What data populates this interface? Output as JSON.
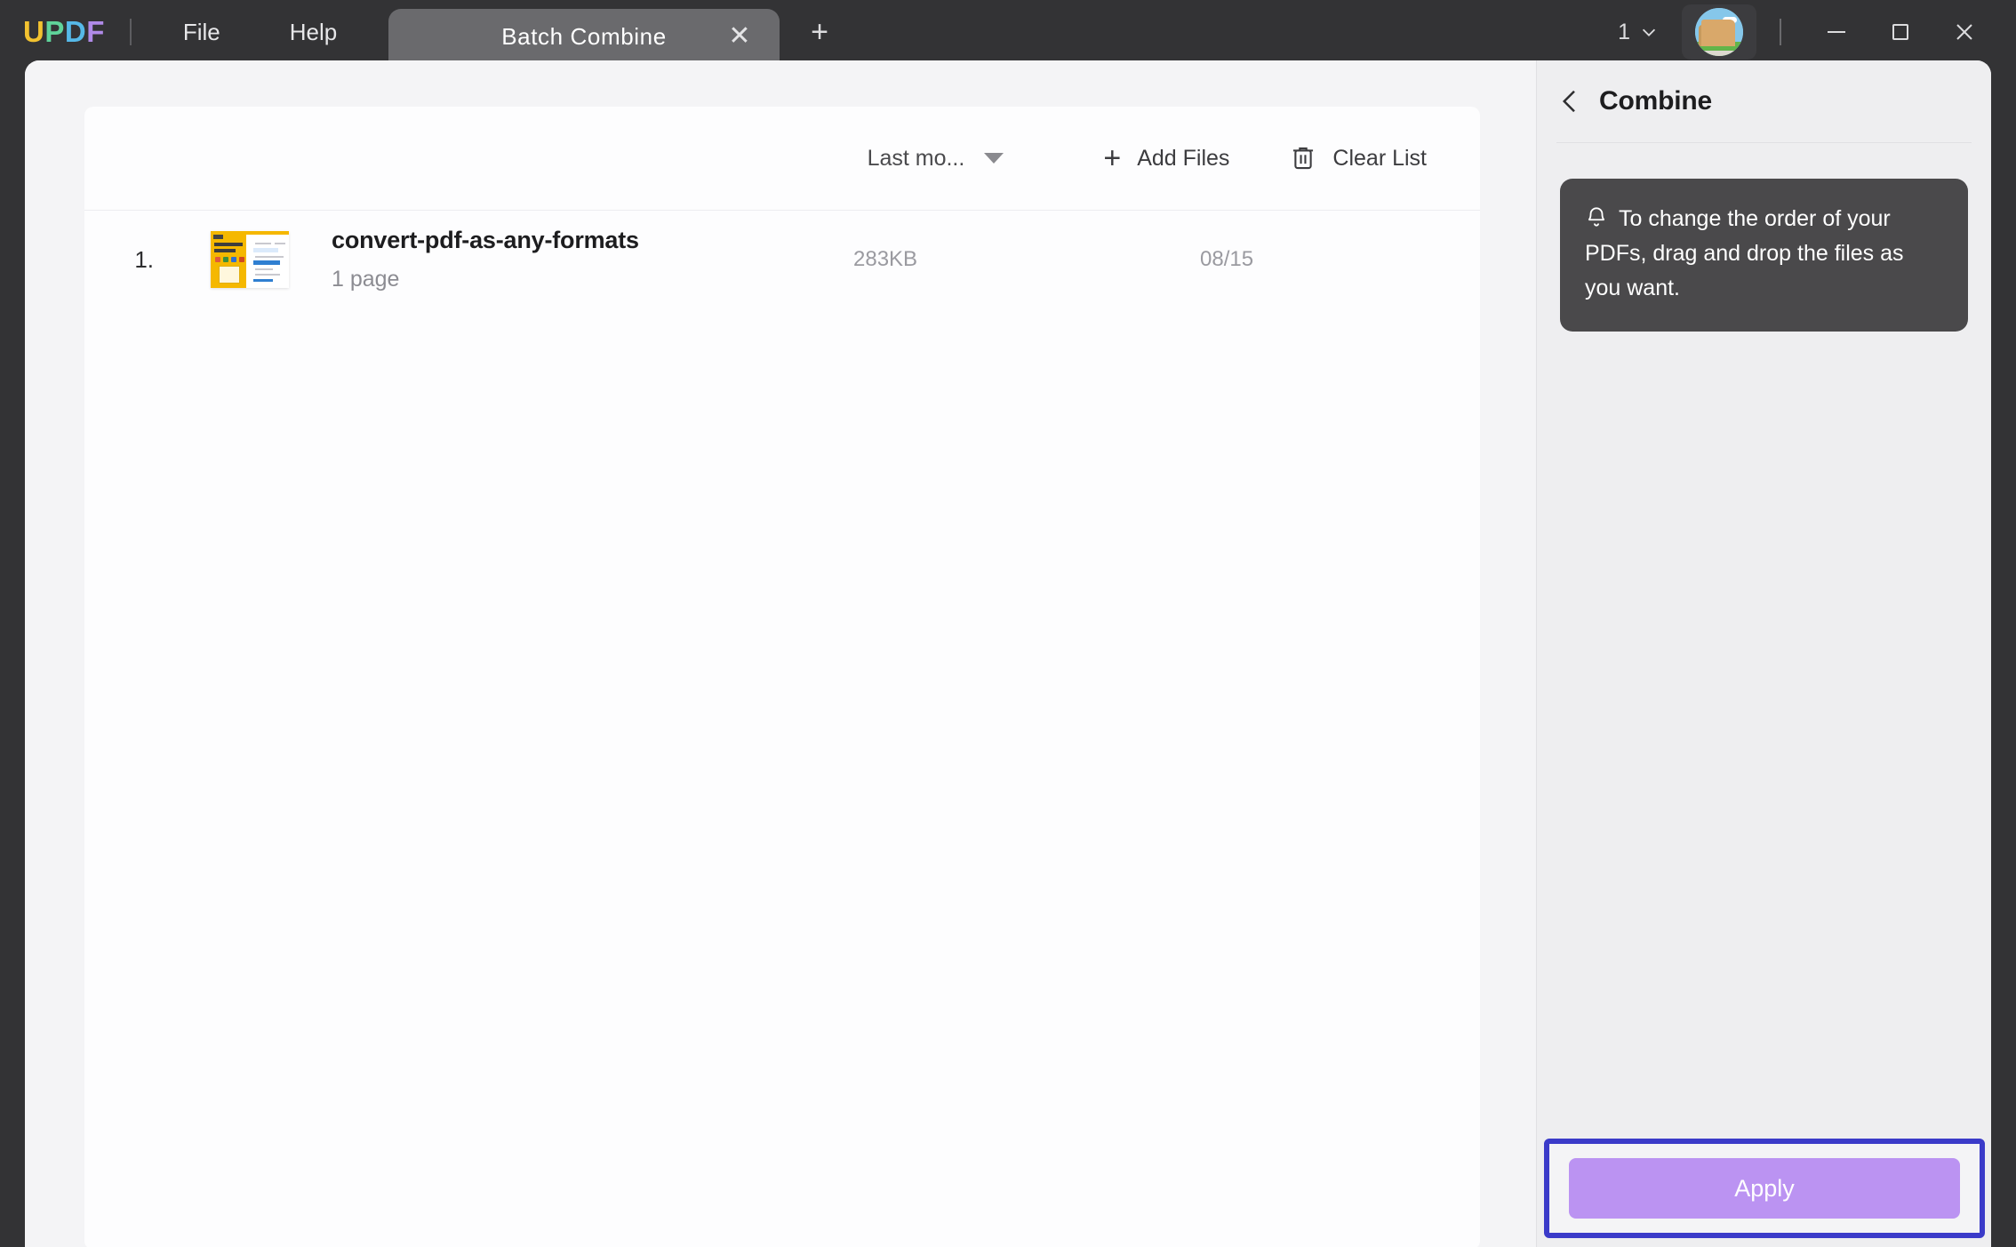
{
  "app": {
    "logo": {
      "l1": "U",
      "l2": "P",
      "l3": "D",
      "l4": "F"
    },
    "menus": [
      {
        "label": "File",
        "name": "menu-file"
      },
      {
        "label": "Help",
        "name": "menu-help"
      }
    ],
    "tab": {
      "title": "Batch Combine",
      "close_icon": "close-icon"
    },
    "new_tab_icon": "plus-icon",
    "page_count": "1",
    "window_controls": {
      "minimize": "minimize-icon",
      "maximize": "maximize-icon",
      "close": "close-icon"
    }
  },
  "toolbar": {
    "sort_label": "Last mo...",
    "add_files_label": "Add Files",
    "clear_list_label": "Clear List",
    "add_icon": "plus-icon",
    "clear_icon": "trash-icon",
    "sort_icon": "chevron-down-icon"
  },
  "files": [
    {
      "index": "1.",
      "name": "convert-pdf-as-any-formats",
      "pages": "1 page",
      "size": "283KB",
      "date": "08/15"
    }
  ],
  "panel": {
    "back_icon": "chevron-left-icon",
    "title": "Combine",
    "notice_icon": "bell-icon",
    "notice": "To change the order of your PDFs, drag and drop the files as you want.",
    "apply_label": "Apply"
  },
  "colors": {
    "titlebar": "#333335",
    "workspace": "#f4f4f6",
    "card": "#fdfdfe",
    "panel": "#eeeef0",
    "notice_bg": "#4a494b",
    "apply_bg": "#bb93f2",
    "highlight_border": "#3b3bc9",
    "logo_u": "#f2c230",
    "logo_p": "#5fd39a",
    "logo_d": "#56b9e8",
    "logo_f": "#b08ae8"
  }
}
